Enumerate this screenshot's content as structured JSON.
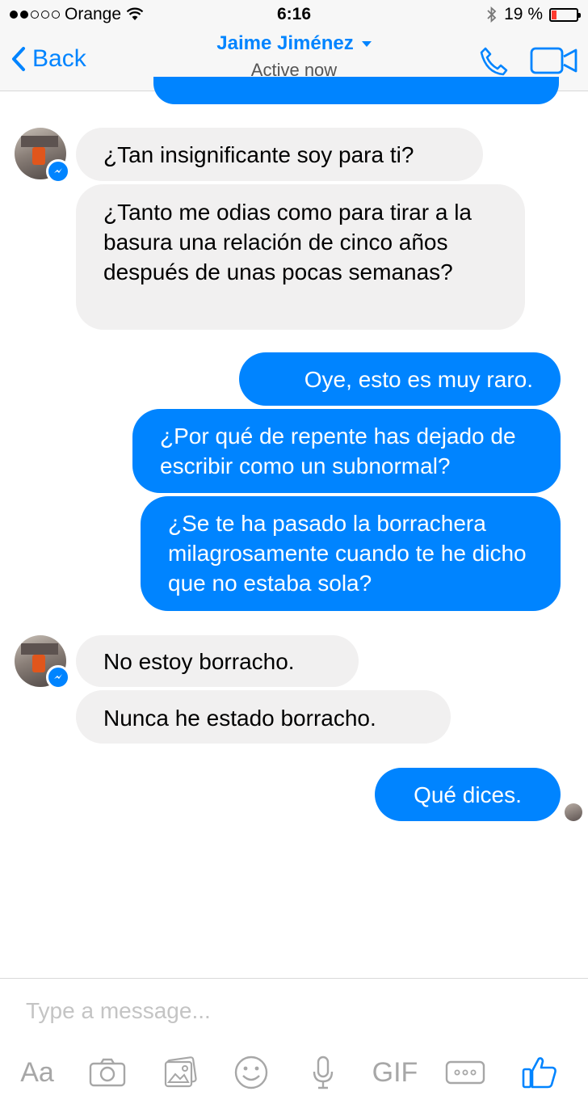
{
  "status_bar": {
    "carrier": "Orange",
    "time": "6:16",
    "battery": "19 %"
  },
  "header": {
    "back_label": "Back",
    "contact_name": "Jaime Jiménez",
    "contact_status": "Active now"
  },
  "messages": [
    {
      "from": "contact",
      "text": "¿Tan insignificante soy para ti?"
    },
    {
      "from": "contact",
      "text": "¿Tanto me odias como para tirar a la basura una relación de cinco años después de unas pocas semanas?"
    },
    {
      "from": "me",
      "text": "Oye, esto es muy raro."
    },
    {
      "from": "me",
      "text": "¿Por qué de repente has dejado de escribir como un subnormal?"
    },
    {
      "from": "me",
      "text": "¿Se te ha pasado la borrachera milagrosamente cuando te he dicho que no estaba sola?"
    },
    {
      "from": "contact",
      "text": "No estoy borracho."
    },
    {
      "from": "contact",
      "text": "Nunca he estado borracho."
    },
    {
      "from": "me",
      "text": "Qué dices."
    }
  ],
  "composer": {
    "placeholder": "Type a message...",
    "tools": {
      "text": "Aa",
      "gif": "GIF"
    }
  },
  "colors": {
    "accent": "#0084ff",
    "incoming_bubble": "#f1f0f0",
    "battery_low": "#ff3b30"
  }
}
